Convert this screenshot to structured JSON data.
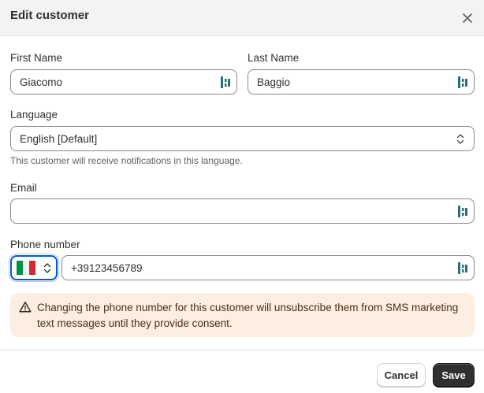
{
  "dialog": {
    "title": "Edit customer"
  },
  "form": {
    "first_name": {
      "label": "First Name",
      "value": "Giacomo"
    },
    "last_name": {
      "label": "Last Name",
      "value": "Baggio"
    },
    "language": {
      "label": "Language",
      "value": "English [Default]",
      "help": "This customer will receive notifications in this language."
    },
    "email": {
      "label": "Email",
      "value": ""
    },
    "phone": {
      "label": "Phone number",
      "value": "+39123456789",
      "country_flag": "italy-flag",
      "flag_colors": [
        "#009246",
        "#ffffff",
        "#ce2b37"
      ]
    }
  },
  "banner": {
    "icon": "alert-triangle-icon",
    "message": "Changing the phone number for this customer will unsubscribe them from SMS marketing text messages until they provide consent."
  },
  "footer": {
    "cancel_label": "Cancel",
    "save_label": "Save"
  },
  "colors": {
    "primary_button": "#303030",
    "focus_ring": "#005bd3",
    "warning_background": "#fdeee2",
    "password_manager_icon": "#2a6e77"
  }
}
